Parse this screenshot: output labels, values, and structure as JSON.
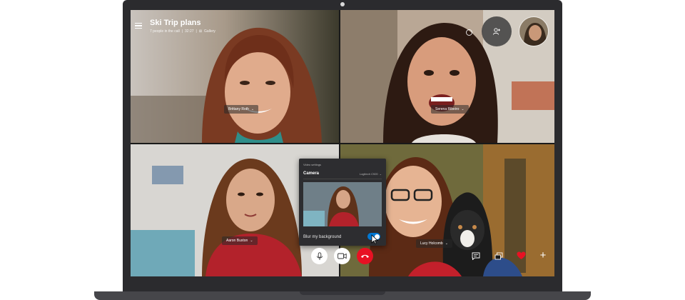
{
  "call": {
    "title": "Ski Trip plans",
    "participants_text": "7 people in the call",
    "duration": "32:27",
    "view_mode": "Gallery"
  },
  "participants": [
    {
      "name": "Brittany Roth"
    },
    {
      "name": "Serena Ribeiro"
    },
    {
      "name": "Aaron Buxton"
    },
    {
      "name": "Lucy Holcomb"
    }
  ],
  "video_settings": {
    "title": "Video settings",
    "camera_label": "Camera",
    "camera_device": "Logitech C920",
    "blur_label": "Blur my background",
    "blur_enabled": true
  },
  "controls": {
    "mic": "mic-icon",
    "video": "video-icon",
    "hangup": "hangup-icon",
    "chat": "chat-icon",
    "share_screen": "share-screen-icon",
    "react": "heart-icon",
    "more": "plus-icon"
  },
  "colors": {
    "hangup": "#e81123",
    "toggle_on": "#0078d4",
    "heart": "#e81123"
  }
}
